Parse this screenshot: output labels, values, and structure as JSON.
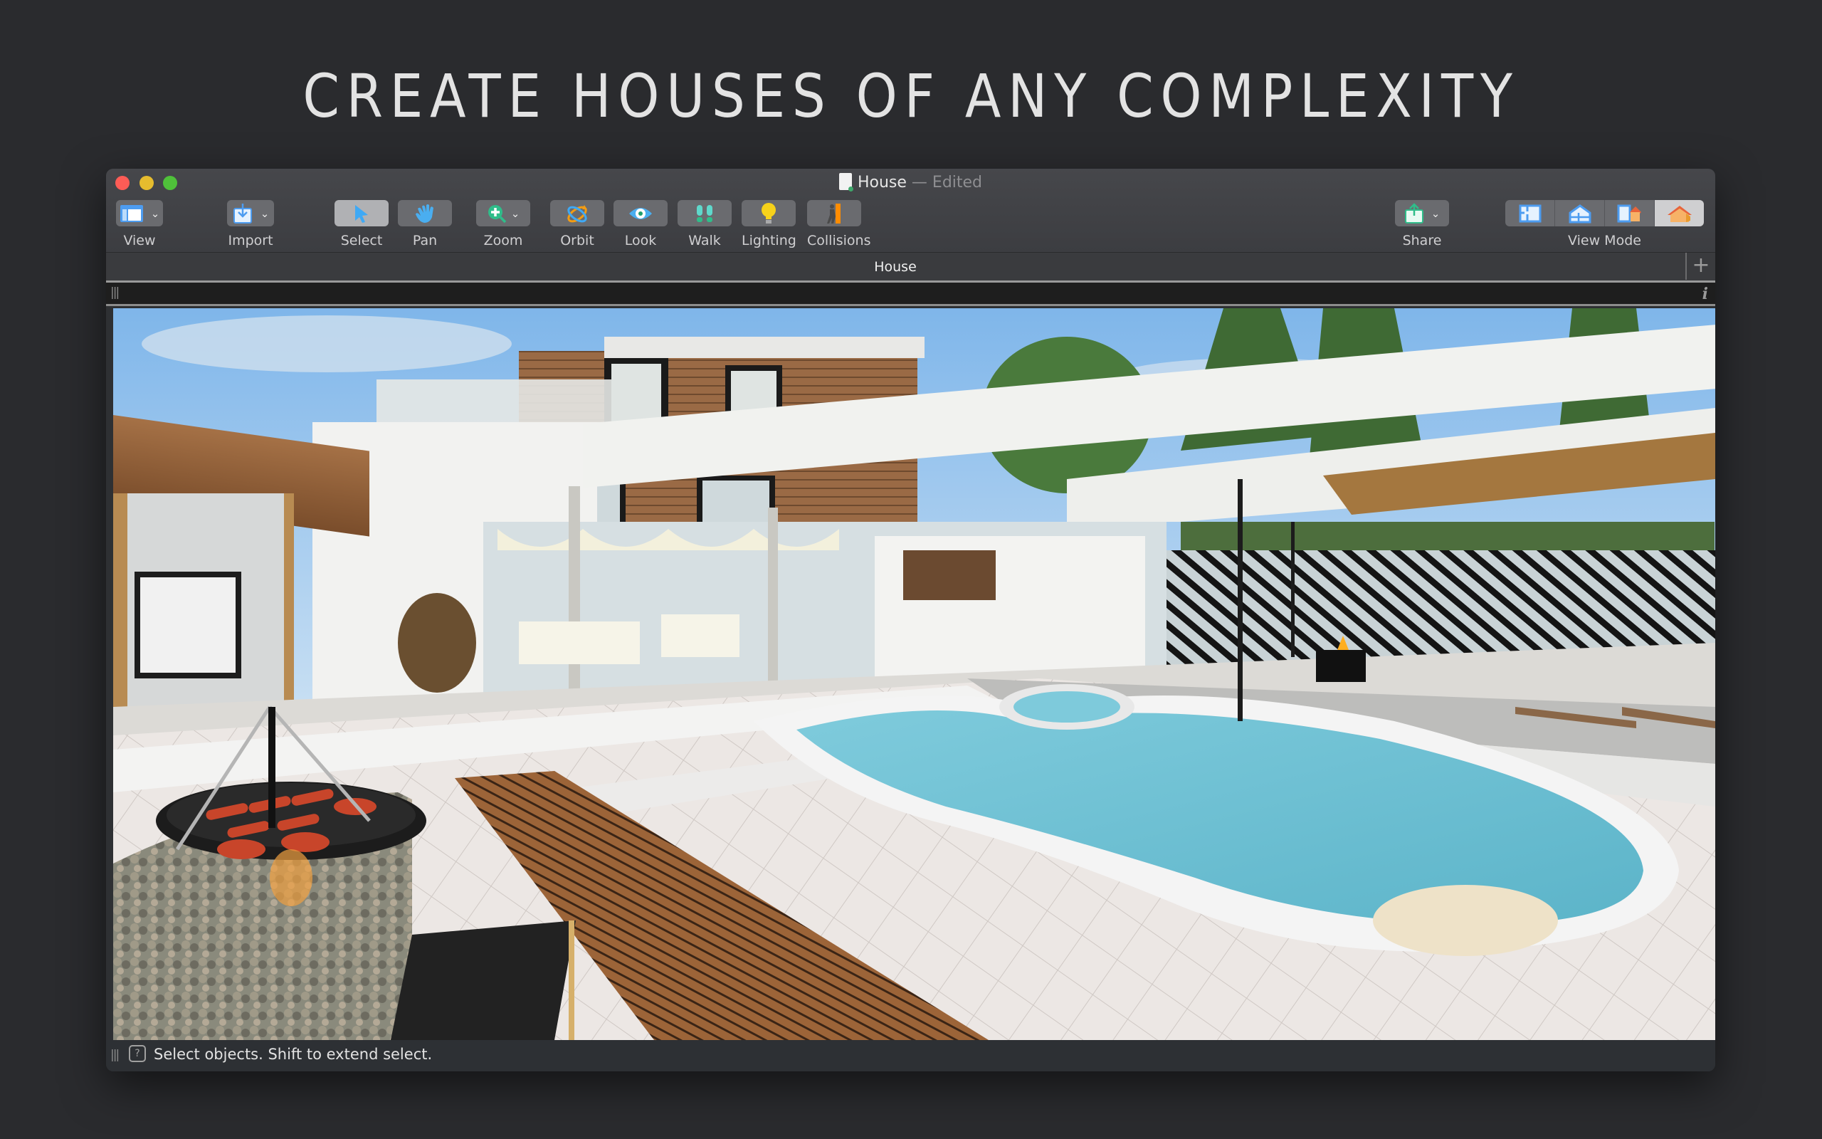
{
  "headline": "CREATE HOUSES OF ANY COMPLEXITY",
  "window": {
    "title": "House",
    "title_suffix": "— Edited",
    "document_icon": "house-document-icon"
  },
  "toolbar": {
    "left": [
      {
        "id": "view",
        "label": "View",
        "icon": "view-layout-icon",
        "dropdown": true
      },
      {
        "id": "import",
        "label": "Import",
        "icon": "import-icon",
        "dropdown": true
      }
    ],
    "tools": [
      {
        "id": "select",
        "label": "Select",
        "icon": "cursor-arrow-icon",
        "active": true
      },
      {
        "id": "pan",
        "label": "Pan",
        "icon": "hand-icon",
        "active": false
      },
      {
        "id": "zoom",
        "label": "Zoom",
        "icon": "zoom-in-icon",
        "dropdown": true,
        "active": false
      },
      {
        "id": "orbit",
        "label": "Orbit",
        "icon": "orbit-icon",
        "active": false
      },
      {
        "id": "look",
        "label": "Look",
        "icon": "eye-icon",
        "active": false
      },
      {
        "id": "walk",
        "label": "Walk",
        "icon": "footprints-icon",
        "active": false
      },
      {
        "id": "lighting",
        "label": "Lighting",
        "icon": "lightbulb-icon",
        "active": false
      },
      {
        "id": "collisions",
        "label": "Collisions",
        "icon": "collision-icon",
        "active": false
      }
    ],
    "share": {
      "label": "Share",
      "icon": "share-icon",
      "dropdown": true
    },
    "view_mode": {
      "label": "View Mode",
      "options": [
        {
          "id": "2d-plan",
          "icon": "floor-plan-icon",
          "selected": false
        },
        {
          "id": "2d-elevation",
          "icon": "elevation-plan-icon",
          "selected": false
        },
        {
          "id": "split",
          "icon": "split-view-icon",
          "selected": false
        },
        {
          "id": "3d",
          "icon": "3d-house-icon",
          "selected": true
        }
      ]
    }
  },
  "tabs": [
    {
      "label": "House",
      "active": true
    }
  ],
  "tab_add_label": "+",
  "info_label": "i",
  "status": {
    "message": "Select objects. Shift to extend select.",
    "help_icon_label": "?"
  },
  "colors": {
    "background": "#2a2b2e",
    "toolbar": "#404145",
    "button": "#6a6b6f",
    "button_active": "#b0b1b4",
    "water": "#6fc1d2",
    "sky": "#8fc0ea"
  }
}
